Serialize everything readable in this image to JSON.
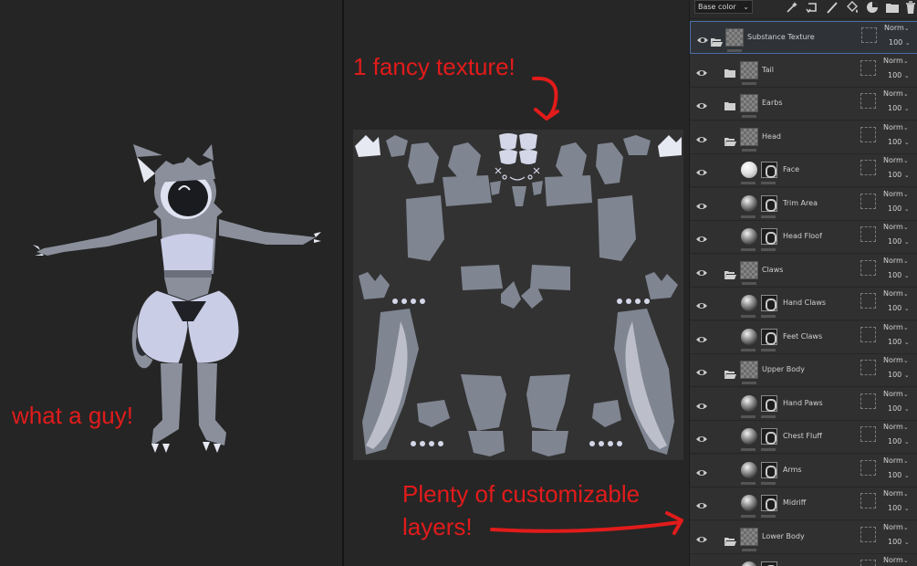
{
  "annotations": {
    "character": "what a guy!",
    "texture": "1 fancy texture!",
    "layers": "Plenty of customizable layers!",
    "layers_line1": "Plenty of customizable",
    "layers_line2": "layers!"
  },
  "colors": {
    "annotation": "#e21b1b",
    "selection_outline": "#4a6fa5",
    "uv_island": "#7f8591",
    "uv_island_light": "#d4d7e8",
    "character_pale": "#c9cde6"
  },
  "toolbar": {
    "channel_select": "Base color",
    "icons": [
      "add-effect-icon",
      "rotate-icon",
      "paint-brush-icon",
      "fill-icon",
      "smart-material-icon",
      "folder-icon",
      "trash-icon"
    ]
  },
  "layers": [
    {
      "name": "Substance Texture",
      "type": "folder",
      "blend": "Norm",
      "opacity": "100",
      "selected": true
    },
    {
      "name": "Tail",
      "type": "folder",
      "blend": "Norm",
      "opacity": "100"
    },
    {
      "name": "Earbs",
      "type": "folder",
      "blend": "Norm",
      "opacity": "100"
    },
    {
      "name": "Head",
      "type": "folder",
      "blend": "Norm",
      "opacity": "100"
    },
    {
      "name": "Face",
      "type": "fill",
      "blend": "Norm",
      "opacity": "100"
    },
    {
      "name": "Trim Area",
      "type": "fill",
      "blend": "Norm",
      "opacity": "100"
    },
    {
      "name": "Head Floof",
      "type": "fill",
      "blend": "Norm",
      "opacity": "100"
    },
    {
      "name": "Claws",
      "type": "folder",
      "blend": "Norm",
      "opacity": "100"
    },
    {
      "name": "Hand Claws",
      "type": "fill",
      "blend": "Norm",
      "opacity": "100"
    },
    {
      "name": "Feet Claws",
      "type": "fill",
      "blend": "Norm",
      "opacity": "100"
    },
    {
      "name": "Upper Body",
      "type": "folder",
      "blend": "Norm",
      "opacity": "100"
    },
    {
      "name": "Hand Paws",
      "type": "fill",
      "blend": "Norm",
      "opacity": "100"
    },
    {
      "name": "Chest Fluff",
      "type": "fill",
      "blend": "Norm",
      "opacity": "100"
    },
    {
      "name": "Arms",
      "type": "fill",
      "blend": "Norm",
      "opacity": "100"
    },
    {
      "name": "Midriff",
      "type": "fill",
      "blend": "Norm",
      "opacity": "100"
    },
    {
      "name": "Lower Body",
      "type": "folder",
      "blend": "Norm",
      "opacity": "100"
    },
    {
      "name": "",
      "type": "fill",
      "blend": "Norm",
      "opacity": ""
    }
  ]
}
